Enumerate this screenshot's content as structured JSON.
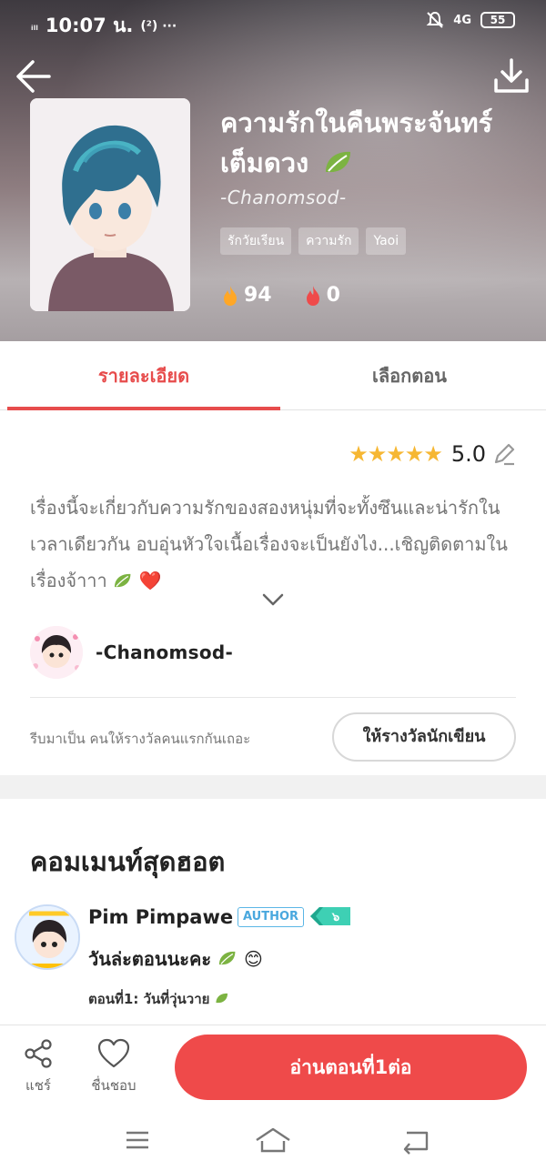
{
  "status_bar": {
    "signal": "ᵢₗₗ",
    "time": "10:07 น.",
    "extra": "(²) ···",
    "network": "4G",
    "battery": "55"
  },
  "story": {
    "title": "ความรักในคืนพระจันทร์เต็มดวง",
    "author": "-Chanomsod-",
    "tags": [
      "รักวัยเรียน",
      "ความรัก",
      "Yaoi"
    ],
    "views": "94",
    "likes": "0"
  },
  "tabs": [
    "รายละเอียด",
    "เลือกตอน"
  ],
  "rating": {
    "stars": "★★★★★",
    "value": "5.0"
  },
  "description": "เรื่องนี้จะเกี่ยวกับความรักของสองหนุ่มที่จะทั้งซึนและน่ารักในเวลาเดียวกัน อบอุ่นหัวใจเนื้อเรื่องจะเป็นยังไง...เชิญติดตามในเรื่องจ้าาา",
  "desc_emoji": "❤️",
  "author_section": {
    "name": "-Chanomsod-",
    "reward_text": "รีบมาเป็น คนให้รางวัลคนแรกกันเถอะ",
    "reward_button": "ให้รางวัลนักเขียน"
  },
  "hot_comments": {
    "title": "คอมเมนท์สุดฮอต",
    "items": [
      {
        "name": "Pim Pimpawe",
        "badge": "AUTHOR",
        "level": "๖",
        "text": "วันล่ะตอนนะคะ",
        "emoji": "😊",
        "episode": "ตอนที่1: วันที่วุ่นวาย"
      }
    ]
  },
  "bottom_bar": {
    "share": "แชร์",
    "like": "ชื่นชอบ",
    "read": "อ่านตอนที่1ต่อ"
  },
  "colors": {
    "accent": "#ef4a4a",
    "star": "#f6b733"
  }
}
